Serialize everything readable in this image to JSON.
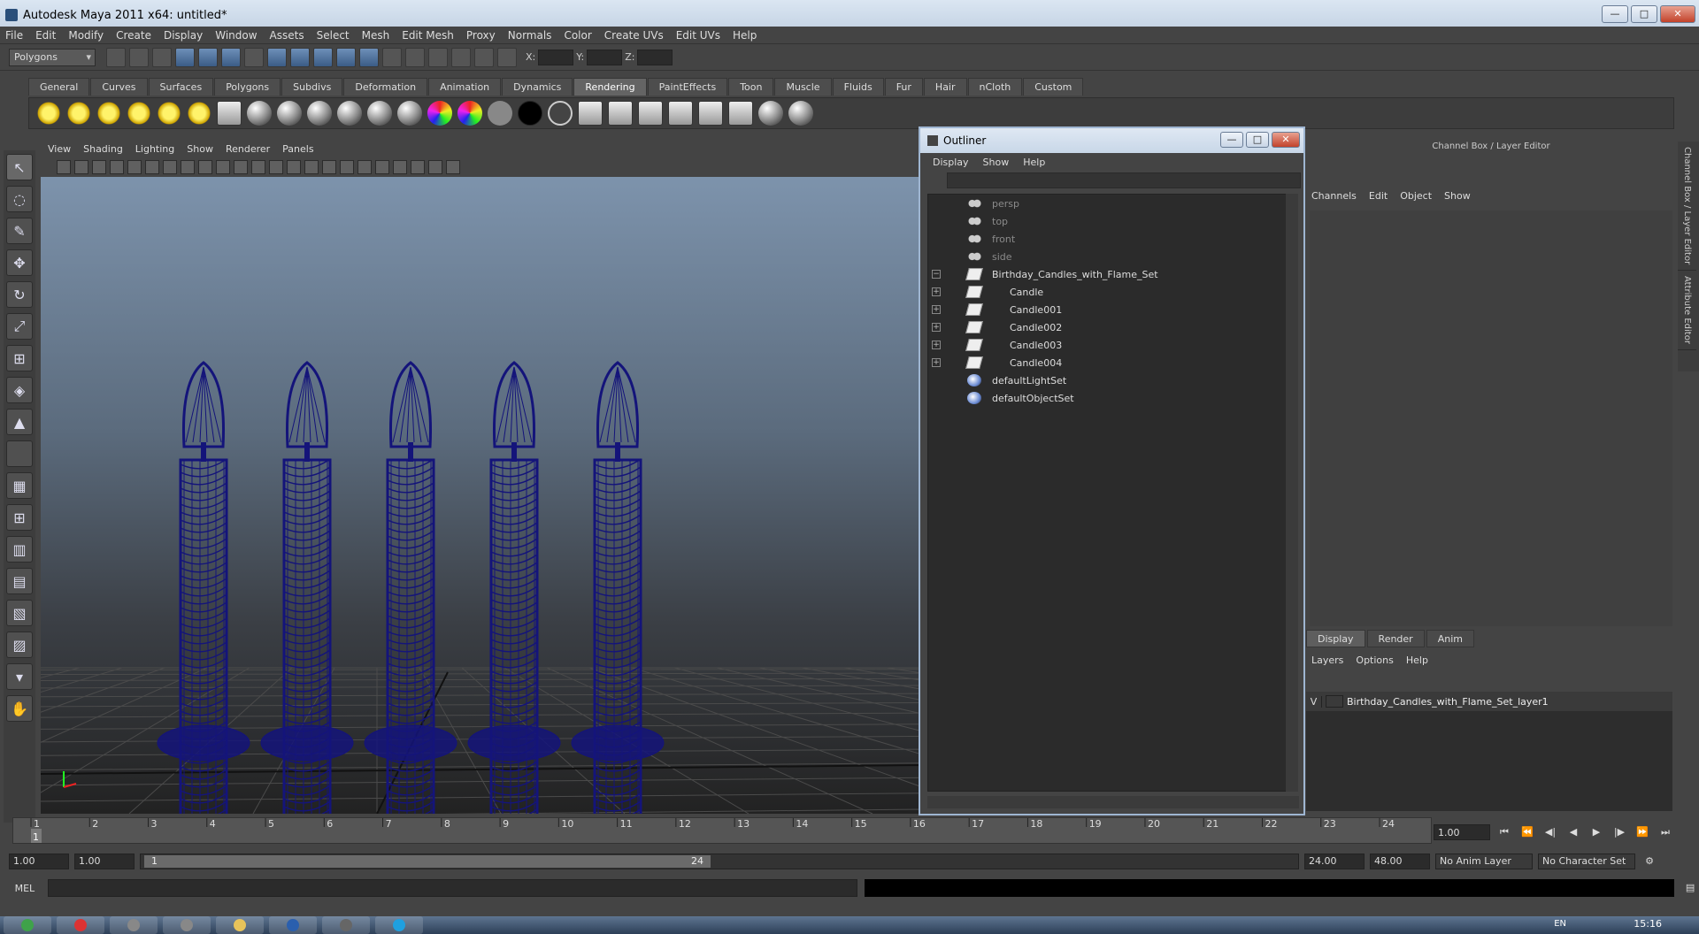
{
  "window": {
    "title": "Autodesk Maya 2011 x64: untitled*"
  },
  "menus": [
    "File",
    "Edit",
    "Modify",
    "Create",
    "Display",
    "Window",
    "Assets",
    "Select",
    "Mesh",
    "Edit Mesh",
    "Proxy",
    "Normals",
    "Color",
    "Create UVs",
    "Edit UVs",
    "Help"
  ],
  "status_line": {
    "mode": "Polygons",
    "x_label": "X:",
    "y_label": "Y:",
    "z_label": "Z:"
  },
  "shelf_tabs": [
    "General",
    "Curves",
    "Surfaces",
    "Polygons",
    "Subdivs",
    "Deformation",
    "Animation",
    "Dynamics",
    "Rendering",
    "PaintEffects",
    "Toon",
    "Muscle",
    "Fluids",
    "Fur",
    "Hair",
    "nCloth",
    "Custom"
  ],
  "active_shelf": "Rendering",
  "viewport_menus": [
    "View",
    "Shading",
    "Lighting",
    "Show",
    "Renderer",
    "Panels"
  ],
  "viewport": {
    "wire_color": "#14147a",
    "candle_count": 5
  },
  "outliner": {
    "title": "Outliner",
    "menus": [
      "Display",
      "Show",
      "Help"
    ],
    "items": [
      {
        "label": "persp",
        "icon": "camera-icon",
        "dim": true,
        "depth": 0,
        "expand": ""
      },
      {
        "label": "top",
        "icon": "camera-icon",
        "dim": true,
        "depth": 0,
        "expand": ""
      },
      {
        "label": "front",
        "icon": "camera-icon",
        "dim": true,
        "depth": 0,
        "expand": ""
      },
      {
        "label": "side",
        "icon": "camera-icon",
        "dim": true,
        "depth": 0,
        "expand": ""
      },
      {
        "label": "Birthday_Candles_with_Flame_Set",
        "icon": "transform-icon",
        "dim": false,
        "depth": 0,
        "expand": "−"
      },
      {
        "label": "Candle",
        "icon": "transform-icon",
        "dim": false,
        "depth": 1,
        "expand": "+"
      },
      {
        "label": "Candle001",
        "icon": "transform-icon",
        "dim": false,
        "depth": 1,
        "expand": "+"
      },
      {
        "label": "Candle002",
        "icon": "transform-icon",
        "dim": false,
        "depth": 1,
        "expand": "+"
      },
      {
        "label": "Candle003",
        "icon": "transform-icon",
        "dim": false,
        "depth": 1,
        "expand": "+"
      },
      {
        "label": "Candle004",
        "icon": "transform-icon",
        "dim": false,
        "depth": 1,
        "expand": "+"
      },
      {
        "label": "defaultLightSet",
        "icon": "set-icon",
        "dim": false,
        "depth": 0,
        "expand": ""
      },
      {
        "label": "defaultObjectSet",
        "icon": "set-icon",
        "dim": false,
        "depth": 0,
        "expand": ""
      }
    ]
  },
  "channel_box": {
    "title": "Channel Box / Layer Editor",
    "menus": [
      "Channels",
      "Edit",
      "Object",
      "Show"
    ]
  },
  "layer_editor": {
    "tabs": [
      "Display",
      "Render",
      "Anim"
    ],
    "menus": [
      "Layers",
      "Options",
      "Help"
    ],
    "layer": {
      "visibility": "V",
      "name": "Birthday_Candles_with_Flame_Set_layer1"
    }
  },
  "side_tabs": [
    "Channel Box / Layer Editor",
    "Attribute Editor"
  ],
  "time_slider": {
    "ticks": [
      "1",
      "2",
      "3",
      "4",
      "5",
      "6",
      "7",
      "8",
      "9",
      "10",
      "11",
      "12",
      "13",
      "14",
      "15",
      "16",
      "17",
      "18",
      "19",
      "20",
      "21",
      "22",
      "23",
      "24"
    ],
    "current_frame": "1",
    "current_time": "1.00"
  },
  "range_slider": {
    "start": "1.00",
    "inner_start": "1.00",
    "range_start": "1",
    "range_end": "24",
    "end": "24.00",
    "outer_end": "48.00",
    "anim_layer": "No Anim Layer",
    "char_set": "No Character Set"
  },
  "command_line": {
    "label": "MEL"
  },
  "taskbar": {
    "lang": "EN",
    "clock": "15:16"
  }
}
